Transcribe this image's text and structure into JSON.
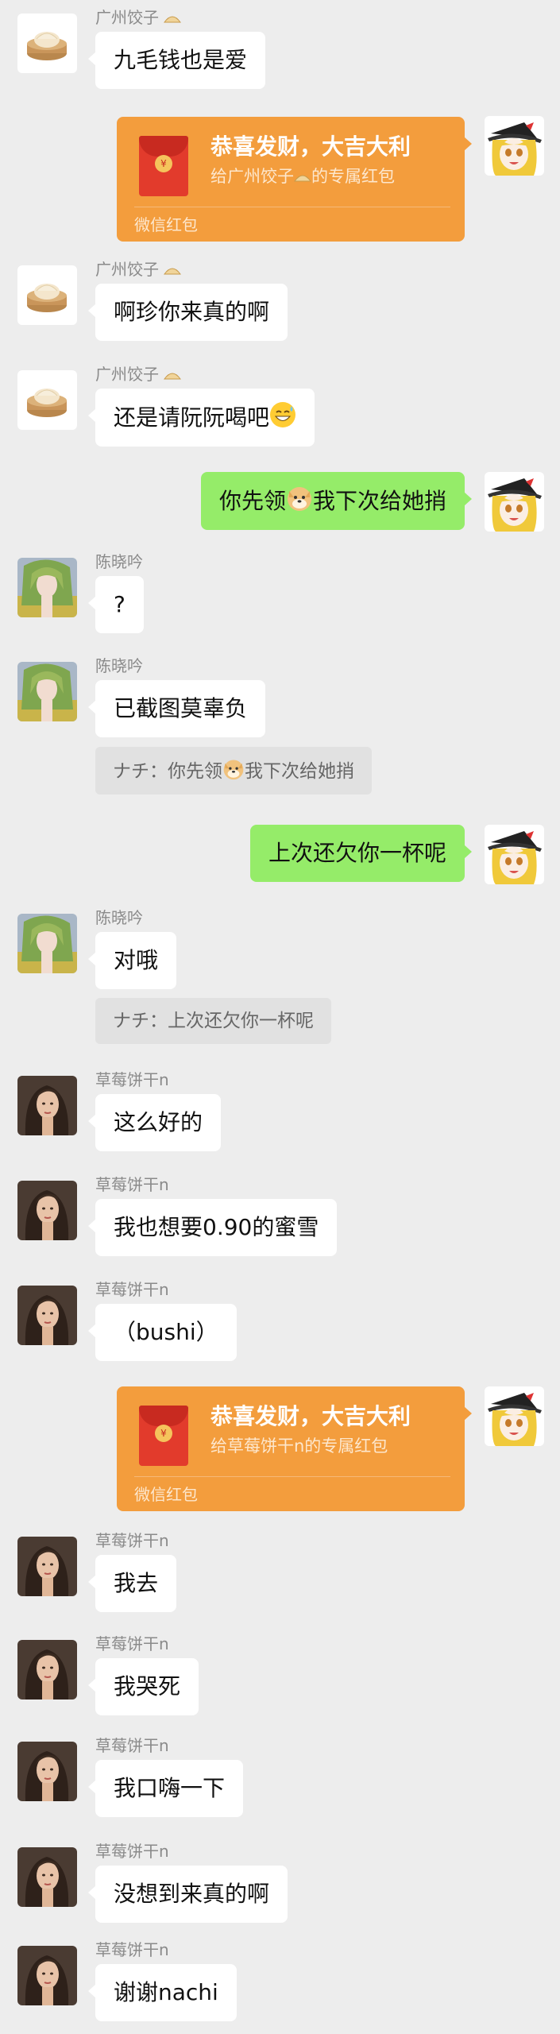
{
  "colors": {
    "background": "#ededed",
    "outgoing_bubble": "#95ec69",
    "incoming_bubble": "#ffffff",
    "red_packet": "#f39d3d"
  },
  "icons": {
    "dumpling": "dumpling-avatar-icon",
    "sweat_smile": "sweat-smile-emoji-icon",
    "doge": "doge-emoji-icon",
    "envelope": "red-envelope-icon"
  },
  "messages": [
    {
      "sender": "广州饺子",
      "text": "九毛钱也是爱"
    },
    {
      "sender": "me",
      "packet": {
        "title": "恭喜发财，大吉大利",
        "subtitle_pre": "给广州饺子",
        "subtitle_post": "的专属红包",
        "footer": "微信红包"
      }
    },
    {
      "sender": "广州饺子",
      "text": "啊珍你来真的啊"
    },
    {
      "sender": "广州饺子",
      "text": "还是请阮阮喝吧"
    },
    {
      "sender": "me",
      "text_pre": "你先领",
      "text_post": "我下次给她捎"
    },
    {
      "sender": "陈晓吟",
      "text": "?"
    },
    {
      "sender": "陈晓吟",
      "text": "已截图莫辜负",
      "quote_pre": "ナチ：你先领",
      "quote_post": "我下次给她捎"
    },
    {
      "sender": "me",
      "text": "上次还欠你一杯呢"
    },
    {
      "sender": "陈晓吟",
      "text": "对哦",
      "quote": "ナチ：上次还欠你一杯呢"
    },
    {
      "sender": "草莓饼干n",
      "text": "这么好的"
    },
    {
      "sender": "草莓饼干n",
      "text": "我也想要0.90的蜜雪"
    },
    {
      "sender": "草莓饼干n",
      "text": "（bushi）"
    },
    {
      "sender": "me",
      "packet": {
        "title": "恭喜发财，大吉大利",
        "subtitle": "给草莓饼干n的专属红包",
        "footer": "微信红包"
      }
    },
    {
      "sender": "草莓饼干n",
      "text": "我去"
    },
    {
      "sender": "草莓饼干n",
      "text": "我哭死"
    },
    {
      "sender": "草莓饼干n",
      "text": "我口嗨一下"
    },
    {
      "sender": "草莓饼干n",
      "text": "没想到来真的啊"
    },
    {
      "sender": "草莓饼干n",
      "text": "谢谢nachi"
    }
  ]
}
